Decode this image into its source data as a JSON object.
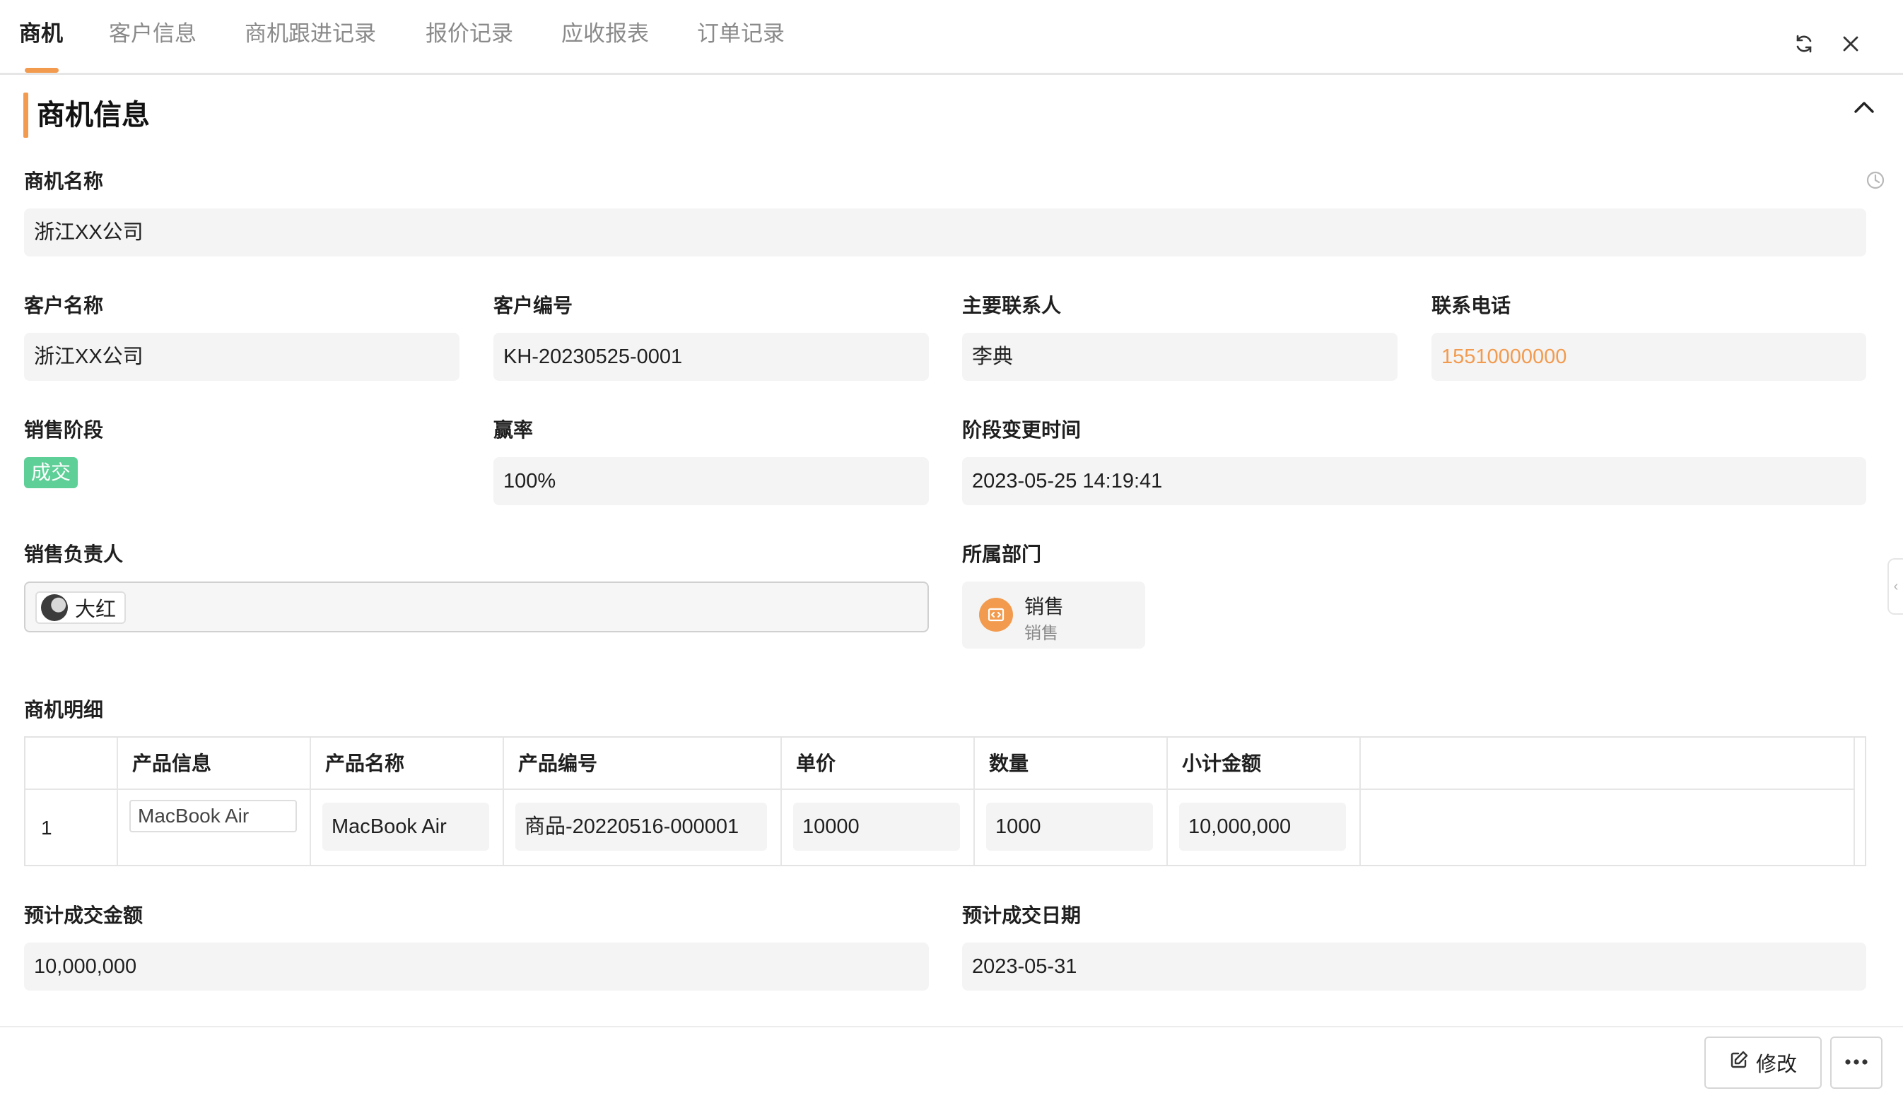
{
  "tabs": [
    {
      "label": "商机",
      "active": true
    },
    {
      "label": "客户信息",
      "active": false
    },
    {
      "label": "商机跟进记录",
      "active": false
    },
    {
      "label": "报价记录",
      "active": false
    },
    {
      "label": "应收报表",
      "active": false
    },
    {
      "label": "订单记录",
      "active": false
    }
  ],
  "header_icons": {
    "refresh": "refresh-icon",
    "close": "close-icon"
  },
  "section": {
    "title": "商机信息",
    "collapse_icon": "chevron-up-icon"
  },
  "fields": {
    "opportunity_name": {
      "label": "商机名称",
      "value": "浙江XX公司"
    },
    "customer_name": {
      "label": "客户名称",
      "value": "浙江XX公司"
    },
    "customer_no": {
      "label": "客户编号",
      "value": "KH-20230525-0001"
    },
    "contact": {
      "label": "主要联系人",
      "value": "李典"
    },
    "phone": {
      "label": "联系电话",
      "value": "15510000000"
    },
    "stage": {
      "label": "销售阶段",
      "value": "成交"
    },
    "win_rate": {
      "label": "赢率",
      "value": "100%"
    },
    "stage_change_time": {
      "label": "阶段变更时间",
      "value": "2023-05-25 14:19:41"
    },
    "owner": {
      "label": "销售负责人",
      "value": "大红"
    },
    "department": {
      "label": "所属部门",
      "name": "销售",
      "sub": "销售"
    },
    "expected_amount": {
      "label": "预计成交金额",
      "value": "10,000,000"
    },
    "expected_date": {
      "label": "预计成交日期",
      "value": "2023-05-31"
    }
  },
  "detail": {
    "label": "商机明细",
    "columns": [
      "产品信息",
      "产品名称",
      "产品编号",
      "单价",
      "数量",
      "小计金额"
    ],
    "rows": [
      {
        "index": "1",
        "product_info": "MacBook Air",
        "product_name": "MacBook Air",
        "product_no": "商品-20220516-000001",
        "unit_price": "10000",
        "quantity": "1000",
        "subtotal": "10,000,000"
      }
    ]
  },
  "footer": {
    "edit_label": "修改",
    "more_icon": "more-icon"
  },
  "colors": {
    "accent": "#f29b4f",
    "stage_badge": "#5ecf97"
  }
}
